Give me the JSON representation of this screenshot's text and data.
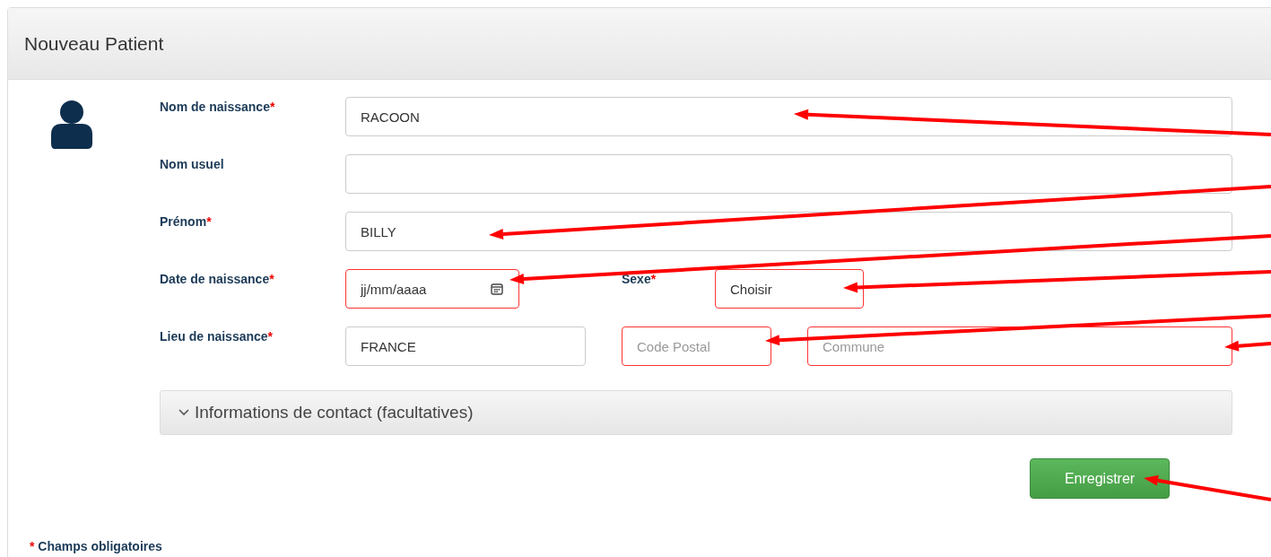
{
  "panel": {
    "title": "Nouveau Patient"
  },
  "rows": [
    {
      "label": "Nom de naissance",
      "required_mark": "*",
      "items": [
        {
          "kind": "text",
          "value": "RACOON",
          "invalid": false
        }
      ]
    },
    {
      "label": "Nom usuel",
      "items": [
        {
          "kind": "text",
          "value": "",
          "invalid": false
        }
      ]
    },
    {
      "label": "Prénom",
      "required_mark": "*",
      "items": [
        {
          "kind": "text",
          "value": "BILLY",
          "invalid": false
        }
      ]
    },
    {
      "label": "Date de naissance",
      "required_mark": "*",
      "items": [
        {
          "kind": "date",
          "value": "jj/mm/aaaa",
          "invalid": true
        },
        {
          "kind": "label",
          "label": "Sexe",
          "required_mark": "*"
        },
        {
          "kind": "select",
          "value": "Choisir",
          "invalid": true
        }
      ]
    },
    {
      "label": "Lieu de naissance",
      "required_mark": "*",
      "items": [
        {
          "kind": "text",
          "value": "FRANCE",
          "invalid": false
        },
        {
          "kind": "text",
          "placeholder": "Code Postal",
          "invalid": true
        },
        {
          "kind": "text",
          "placeholder": "Commune",
          "invalid": true
        }
      ]
    }
  ],
  "accordion": {
    "title": "Informations de contact (facultatives)",
    "expanded": false
  },
  "submit_button": "Enregistrer",
  "footer": {
    "mark": "*",
    "text": "Champs obligatoires"
  }
}
